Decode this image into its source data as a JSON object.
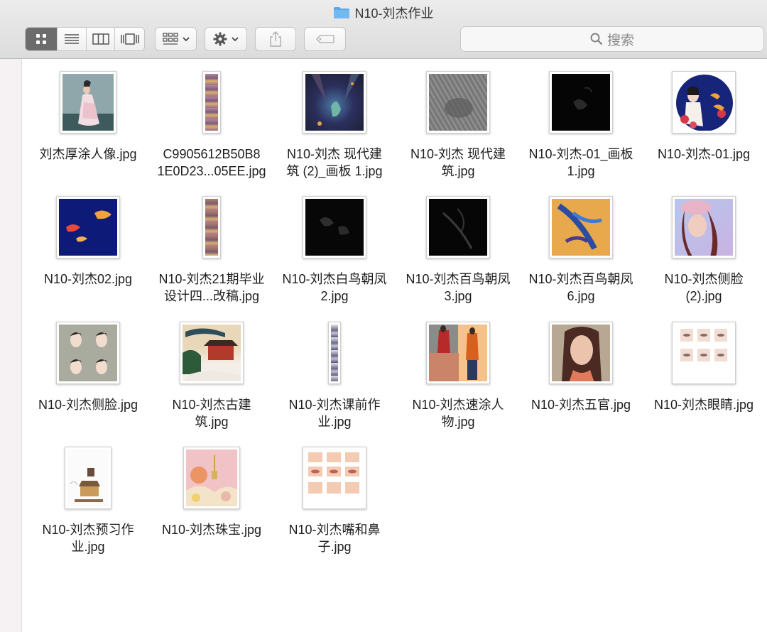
{
  "window": {
    "title": "N10-刘杰作业"
  },
  "toolbar": {
    "view_buttons": [
      {
        "icon": "icon-view-icon",
        "active": true
      },
      {
        "icon": "list-view-icon",
        "active": false
      },
      {
        "icon": "column-view-icon",
        "active": false
      },
      {
        "icon": "gallery-view-icon",
        "active": false
      }
    ],
    "arrange_icon": "arrange-icon",
    "action_icon": "gear-icon",
    "share_icon": "share-icon",
    "tag_icon": "tag-icon"
  },
  "search": {
    "placeholder": "搜索"
  },
  "files": [
    {
      "name": "刘杰厚涂人像.jpg"
    },
    {
      "name": "C9905612B50B8 1E0D23...05EE.jpg"
    },
    {
      "name": "N10-刘杰 现代建筑 (2)_画板 1.jpg"
    },
    {
      "name": "N10-刘杰 现代建筑.jpg"
    },
    {
      "name": "N10-刘杰-01_画板 1.jpg"
    },
    {
      "name": "N10-刘杰-01.jpg"
    },
    {
      "name": "N10-刘杰02.jpg"
    },
    {
      "name": "N10-刘杰21期毕业设计四...改稿.jpg"
    },
    {
      "name": "N10-刘杰白鸟朝凤2.jpg"
    },
    {
      "name": "N10-刘杰百鸟朝凤3.jpg"
    },
    {
      "name": "N10-刘杰百鸟朝凤6.jpg"
    },
    {
      "name": "N10-刘杰侧脸(2).jpg"
    },
    {
      "name": "N10-刘杰侧脸.jpg"
    },
    {
      "name": "N10-刘杰古建筑.jpg"
    },
    {
      "name": "N10-刘杰课前作业.jpg"
    },
    {
      "name": "N10-刘杰速涂人物.jpg"
    },
    {
      "name": "N10-刘杰五官.jpg"
    },
    {
      "name": "N10-刘杰眼睛.jpg"
    },
    {
      "name": "N10-刘杰预习作业.jpg"
    },
    {
      "name": "N10-刘杰珠宝.jpg"
    },
    {
      "name": "N10-刘杰嘴和鼻子.jpg"
    }
  ],
  "display_lines": [
    [
      "刘杰厚涂人像.jpg"
    ],
    [
      "C9905612B50B8",
      "1E0D23...05EE.jpg"
    ],
    [
      "N10-刘杰 现代建",
      "筑 (2)_画板 1.jpg"
    ],
    [
      "N10-刘杰 现代建",
      "筑.jpg"
    ],
    [
      "N10-刘杰-01_画板",
      "1.jpg"
    ],
    [
      "N10-刘杰-01.jpg"
    ],
    [
      "N10-刘杰02.jpg"
    ],
    [
      "N10-刘杰21期毕业",
      "设计四...改稿.jpg"
    ],
    [
      "N10-刘杰白鸟朝凤",
      "2.jpg"
    ],
    [
      "N10-刘杰百鸟朝凤",
      "3.jpg"
    ],
    [
      "N10-刘杰百鸟朝凤",
      "6.jpg"
    ],
    [
      "N10-刘杰侧脸",
      "(2).jpg"
    ],
    [
      "N10-刘杰侧脸.jpg"
    ],
    [
      "N10-刘杰古建",
      "筑.jpg"
    ],
    [
      "N10-刘杰课前作",
      "业.jpg"
    ],
    [
      "N10-刘杰速涂人",
      "物.jpg"
    ],
    [
      "N10-刘杰五官.jpg"
    ],
    [
      "N10-刘杰眼睛.jpg"
    ],
    [
      "N10-刘杰预习作",
      "业.jpg"
    ],
    [
      "N10-刘杰珠宝.jpg"
    ],
    [
      "N10-刘杰嘴和鼻",
      "子.jpg"
    ]
  ]
}
